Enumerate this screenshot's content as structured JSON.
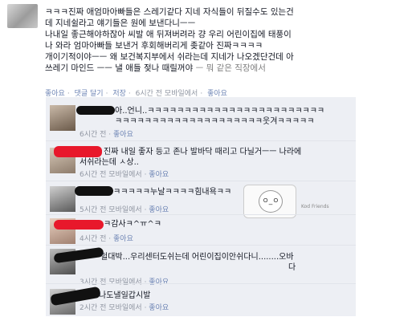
{
  "post": {
    "line1": "ㅋㅋㅋ진짜 애엄마아빠들은 스레기같다 지네 자식들이 뒤질수도 있는건",
    "line2": "데 지네쉴라고 얘기들은 원에 보낸다니ㅡㅡ",
    "line3": "나내일 좋근해야하잖아 씨발 애 뒤져버려라 걍 우리 어린이집에 태풍이",
    "line4": "나 와라 엄마아빠들 보낸거 후회해버리게 좆같아 진짜ㅋㅋㅋㅋ",
    "line5": "개이기적이야ㅡㅡ 왜 보건복지부에서 쉬라는데 지네가 나오겠단건데 아",
    "line6": "쓰레기 마인드 ㅡㅡ 낼 애들 젖나 때릴꺼야",
    "line6b": " ㅡ 뭐 같은 직장에서"
  },
  "actions": {
    "like": "좋아요",
    "comment": "댓글 달기",
    "share": "저장",
    "time": "6시간 전 모바일에서",
    "like2": "좋아요"
  },
  "comments": [
    {
      "text1": "아..언니..ㅋㅋㅋㅋㅋㅋㅋㅋㅋㅋㅋㅋㅋㅋㅋㅋㅋㅋㅋㅋㅋㅋㅋㅋ",
      "text2": "ㅋㅋㅋㅋㅋㅋㅋㅋㅋㅋㅋㅋㅋㅋㅋㅋㅋㅋㅋㅋ웃겨ㅋㅋㅋㅋㅋ",
      "meta": "6시간 전",
      "like": "좋아요"
    },
    {
      "text1": "진짜 내일 좋자 등고 존나 발바닥 때리고 다닐거ㅡㅡ 나라에",
      "text2": "서쉬라는데 ㅅ상..",
      "meta": "6시간 전 모바일에서",
      "like": "좋아요"
    },
    {
      "text1": "ㅋㅋㅋㅋㅋ누날ㅋㅋㅋㅋ힘내욕ㅋㅋ",
      "sticker_caption": "Kod Friends",
      "meta": "5시간 전 모바일에서",
      "like": "좋아요"
    },
    {
      "text1": "ㅋ감사ㅋ^ㅠ^ㅋ",
      "meta": "4시간 전",
      "like": "좋아요"
    },
    {
      "text1": "헐대박...우리센터도쉬는데 어린이집이안쉬다니........오바",
      "text2": "다",
      "meta": "3시간 전 모바일에서",
      "like": "좋아요"
    },
    {
      "text1": "나도낼일갑시발",
      "meta": "2시간 전 모바일에서",
      "like": "좋아요"
    }
  ]
}
